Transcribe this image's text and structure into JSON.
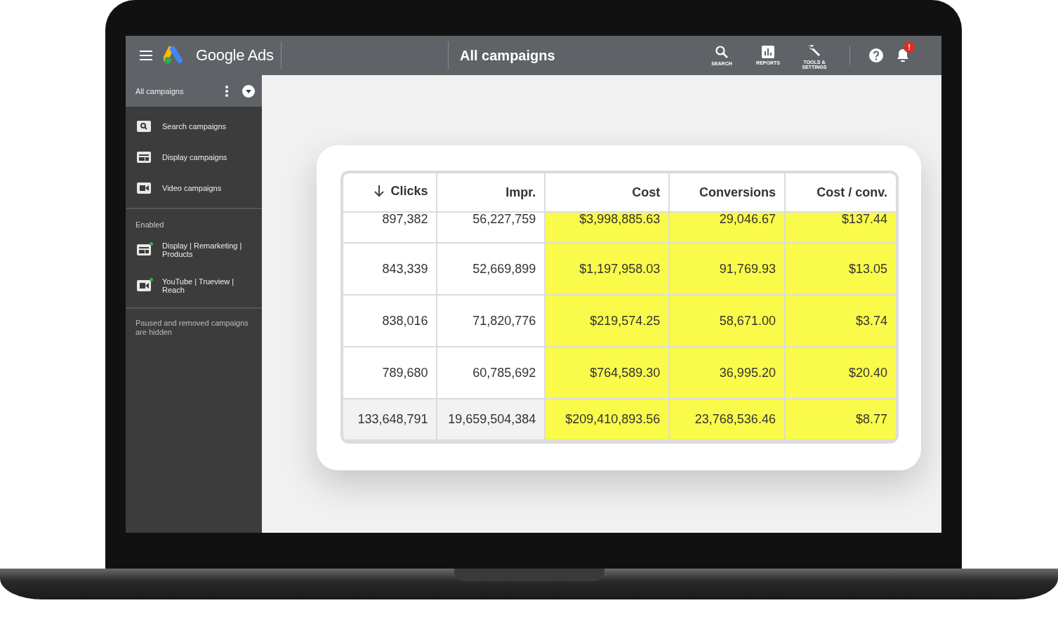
{
  "header": {
    "product_name": "Google Ads",
    "page_title": "All campaigns",
    "toolbar": [
      {
        "label": "SEARCH",
        "kind": "search"
      },
      {
        "label": "REPORTS",
        "kind": "reports"
      },
      {
        "label": "TOOLS & SETTINGS",
        "kind": "tools"
      }
    ],
    "notification_badge": "!"
  },
  "sidebar": {
    "selector": "All campaigns",
    "types": [
      {
        "label": "Search campaigns",
        "kind": "search"
      },
      {
        "label": "Display campaigns",
        "kind": "display"
      },
      {
        "label": "Video campaigns",
        "kind": "video"
      }
    ],
    "section": "Enabled",
    "campaigns": [
      {
        "label": "Display | Remarketing | Products",
        "kind": "display",
        "enabled": true
      },
      {
        "label": "YouTube | Trueview | Reach",
        "kind": "video",
        "enabled": true
      }
    ],
    "footer": "Paused and removed campaigns are hidden"
  },
  "table": {
    "columns": [
      {
        "label": "Clicks",
        "sorted": true,
        "highlighted": false
      },
      {
        "label": "Impr.",
        "sorted": false,
        "highlighted": false
      },
      {
        "label": "Cost",
        "sorted": false,
        "highlighted": true
      },
      {
        "label": "Conversions",
        "sorted": false,
        "highlighted": true
      },
      {
        "label": "Cost / conv.",
        "sorted": false,
        "highlighted": true
      }
    ],
    "rows": [
      {
        "kind": "partial",
        "cells": [
          "897,382",
          "56,227,759",
          "$3,998,885.63",
          "29,046.67",
          "$137.44"
        ]
      },
      {
        "kind": "data",
        "cells": [
          "843,339",
          "52,669,899",
          "$1,197,958.03",
          "91,769.93",
          "$13.05"
        ]
      },
      {
        "kind": "data",
        "cells": [
          "838,016",
          "71,820,776",
          "$219,574.25",
          "58,671.00",
          "$3.74"
        ]
      },
      {
        "kind": "data",
        "cells": [
          "789,680",
          "60,785,692",
          "$764,589.30",
          "36,995.20",
          "$20.40"
        ]
      },
      {
        "kind": "total",
        "cells": [
          "133,648,791",
          "19,659,504,384",
          "$209,410,893.56",
          "23,768,536.46",
          "$8.77"
        ]
      }
    ]
  }
}
